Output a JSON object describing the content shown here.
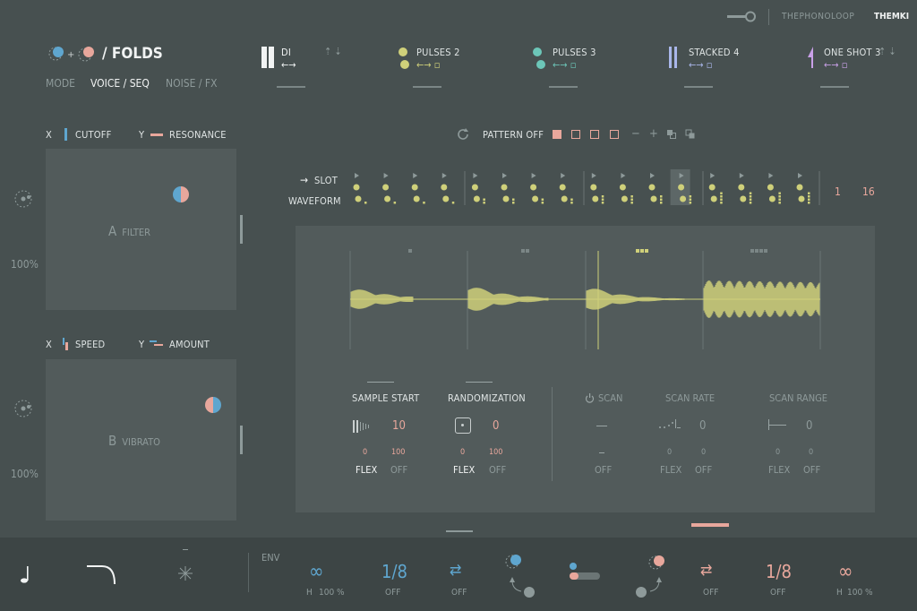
{
  "topbar": {
    "wrench_icon": "wrench-icon",
    "brand_pre": "THE",
    "brand_main": "PHONOLOOP",
    "user": "THEMKI"
  },
  "preset": {
    "name": "/ FOLDS",
    "tabs": [
      "MODE",
      "VOICE / SEQ",
      "NOISE / FX"
    ],
    "active_tab": "VOICE / SEQ"
  },
  "slots": [
    {
      "name": "DI",
      "color": "#f1f3f3"
    },
    {
      "name": "PULSES 2",
      "color": "#cfd07a"
    },
    {
      "name": "PULSES 3",
      "color": "#6cc6b8"
    },
    {
      "name": "STACKED 4",
      "color": "#a9b6ea"
    },
    {
      "name": "ONE SHOT 3",
      "color": "#c9a0e8"
    }
  ],
  "xy_pads": [
    {
      "pad_label_letter": "A",
      "pad_label": "FILTER",
      "x_label": "CUTOFF",
      "y_label": "RESONANCE",
      "x_key": "X",
      "y_key": "Y",
      "amount": "100%"
    },
    {
      "pad_label_letter": "B",
      "pad_label": "VIBRATO",
      "x_label": "SPEED",
      "y_label": "AMOUNT",
      "x_key": "X",
      "y_key": "Y",
      "amount": "100%"
    }
  ],
  "pattern": {
    "label": "PATTERN OFF",
    "slot_label": "SLOT",
    "waveform_label": "WAVEFORM",
    "start": "1",
    "end": "16"
  },
  "params": {
    "sample_start": {
      "label": "SAMPLE START",
      "value": "10",
      "min": "0",
      "max": "100",
      "flex": "FLEX",
      "off": "OFF"
    },
    "randomization": {
      "label": "RANDOMIZATION",
      "value": "0",
      "min": "0",
      "max": "100",
      "flex": "FLEX",
      "off": "OFF"
    },
    "scan": {
      "label": "SCAN",
      "off": "OFF"
    },
    "scan_rate": {
      "label": "SCAN RATE",
      "value": "0",
      "min": "0",
      "max": "0",
      "flex": "FLEX",
      "off": "OFF"
    },
    "scan_range": {
      "label": "SCAN RANGE",
      "value": "0",
      "min": "0",
      "max": "0",
      "flex": "FLEX",
      "off": "OFF"
    }
  },
  "bottom": {
    "env_label": "ENV",
    "left_h": "H",
    "left_pct": "100 %",
    "left_div": "1/8",
    "off": "OFF",
    "right_div": "1/8",
    "right_h": "H",
    "right_pct": "100 %"
  },
  "colors": {
    "background": "#475050",
    "panel": "#525b5b",
    "yellow": "#cfd07a",
    "salmon": "#e8a79c",
    "blue": "#5fa6cf",
    "teal": "#6cc6b8"
  }
}
